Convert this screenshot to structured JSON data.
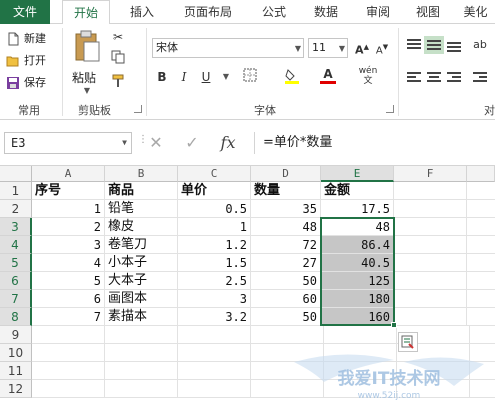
{
  "tabs": [
    "文件",
    "开始",
    "插入",
    "页面布局",
    "公式",
    "数据",
    "审阅",
    "视图",
    "美化"
  ],
  "clipboard": {
    "new_label": "新建",
    "open_label": "打开",
    "save_label": "保存",
    "common_group": "常用",
    "paste_label": "粘贴",
    "clipboard_group": "剪贴板"
  },
  "font": {
    "name": "宋体",
    "size": "11",
    "group_label": "字体",
    "phonetic_label": "wén",
    "fill_color": "#ffff00",
    "font_color": "#e00000"
  },
  "alignment": {
    "group_label_partial": "对"
  },
  "formula_bar": {
    "name_box": "E3",
    "formula": "=单价*数量"
  },
  "columns": [
    "A",
    "B",
    "C",
    "D",
    "E",
    "F"
  ],
  "rows": [
    "1",
    "2",
    "3",
    "4",
    "5",
    "6",
    "7",
    "8",
    "9",
    "10",
    "11",
    "12"
  ],
  "table": {
    "headers": [
      "序号",
      "商品",
      "单价",
      "数量",
      "金额"
    ],
    "data": [
      [
        "1",
        "铅笔",
        "0.5",
        "35",
        "17.5"
      ],
      [
        "2",
        "橡皮",
        "1",
        "48",
        "48"
      ],
      [
        "3",
        "卷笔刀",
        "1.2",
        "72",
        "86.4"
      ],
      [
        "4",
        "小本子",
        "1.5",
        "27",
        "40.5"
      ],
      [
        "5",
        "大本子",
        "2.5",
        "50",
        "125"
      ],
      [
        "6",
        "画图本",
        "3",
        "60",
        "180"
      ],
      [
        "7",
        "素描本",
        "3.2",
        "50",
        "160"
      ]
    ]
  },
  "selection": {
    "range": "E3:E8"
  },
  "watermark": {
    "title": "我爱IT技术网",
    "url": "www.52ij.com"
  },
  "colors": {
    "accent": "#217346",
    "selection_fill": "#c6c6c6"
  },
  "icons": [
    "new-file-icon",
    "open-folder-icon",
    "save-icon",
    "paste-icon",
    "cut-icon",
    "copy-icon",
    "format-painter-icon",
    "bold-icon",
    "italic-icon",
    "underline-icon",
    "border-icon",
    "fill-color-icon",
    "font-color-icon",
    "cancel-icon",
    "enter-icon",
    "function-icon",
    "quick-analysis-icon"
  ]
}
